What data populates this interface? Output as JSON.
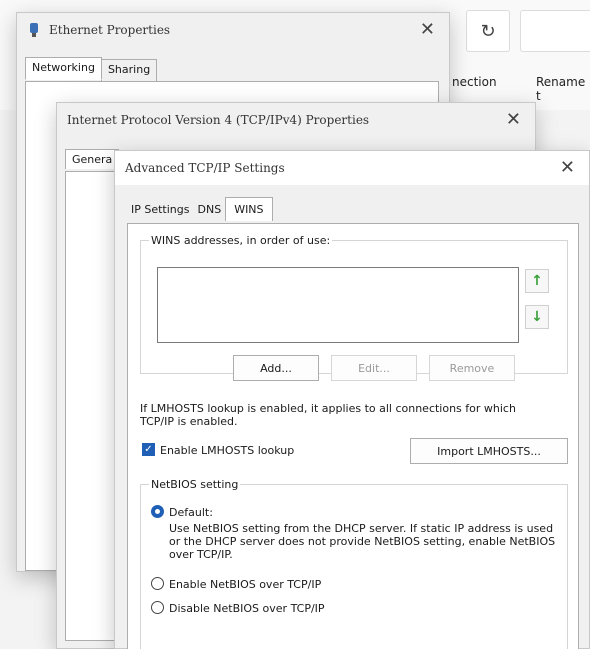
{
  "background": {
    "refresh_icon": "refresh-icon",
    "cmd1": "nection",
    "cmd2": "Rename t"
  },
  "ethernet": {
    "title": "Ethernet Properties",
    "close": "✕",
    "tabs": [
      "Networking",
      "Sharing"
    ]
  },
  "ipv4": {
    "title": "Internet Protocol Version 4 (TCP/IPv4) Properties",
    "close": "✕",
    "tab": "Genera"
  },
  "advanced": {
    "title": "Advanced TCP/IP Settings",
    "close": "✕",
    "tabs": [
      "IP Settings",
      "DNS",
      "WINS"
    ],
    "active_tab": "WINS",
    "wins": {
      "group_label": "WINS addresses, in order of use:",
      "add": "Add...",
      "edit": "Edit...",
      "remove": "Remove",
      "lmhosts_note": "If LMHOSTS lookup is enabled, it applies to all connections for which TCP/IP is enabled.",
      "enable_lmhosts": "Enable LMHOSTS lookup",
      "enable_lmhosts_checked": true,
      "import": "Import LMHOSTS...",
      "netbios_label": "NetBIOS setting",
      "default_label": "Default:",
      "default_desc": "Use NetBIOS setting from the DHCP server. If static IP address is used or the DHCP server does not provide NetBIOS setting, enable NetBIOS over TCP/IP.",
      "enable_netbios": "Enable NetBIOS over TCP/IP",
      "disable_netbios": "Disable NetBIOS over TCP/IP",
      "selected_netbios": "default"
    }
  },
  "colors": {
    "accent": "#1f5fb5",
    "arrow_green": "#3aa13a"
  }
}
